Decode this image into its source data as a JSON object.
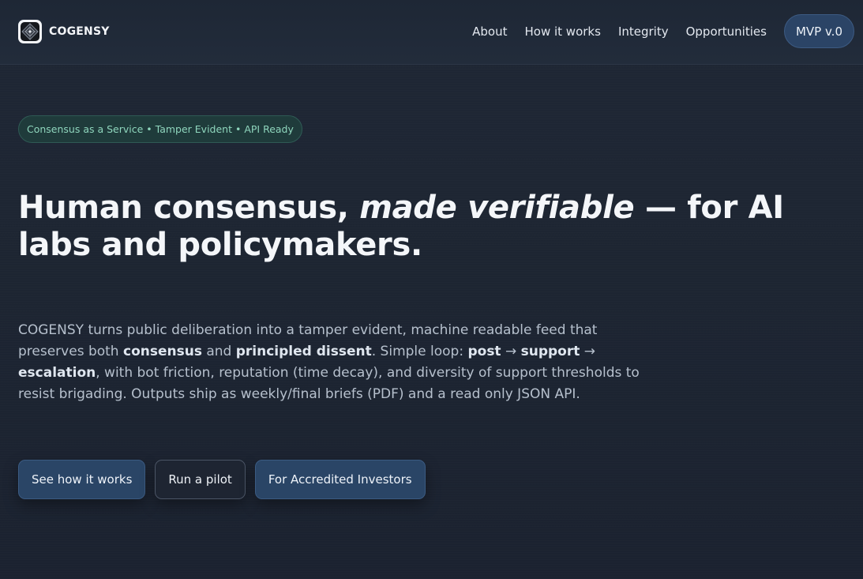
{
  "header": {
    "brand": "COGENSY",
    "logo_icon": "cogensy-logo-icon",
    "nav": [
      "About",
      "How it works",
      "Integrity",
      "Opportunities"
    ],
    "version_badge": "MVP v.0"
  },
  "hero": {
    "tagline": "Consensus as a Service • Tamper Evident • API Ready",
    "headline": {
      "part1": "Human consensus, ",
      "emphasis": "made verifiable",
      "part2": " — for AI labs and policymakers."
    },
    "description": {
      "t1": "COGENSY turns public deliberation into a tamper evident, machine readable feed that preserves both ",
      "b1": "consensus",
      "t2": " and ",
      "b2": "principled dissent",
      "t3": ". Simple loop: ",
      "b3": "post",
      "t4": " → ",
      "b4": "support",
      "t5": " → ",
      "b5": "escalation",
      "t6": ", with bot friction, reputation (time decay), and diversity of support thresholds to resist brigading. Outputs ship as weekly/final briefs (PDF) and a read only JSON API."
    },
    "buttons": {
      "primary": "See how it works",
      "secondary": "Run a pilot",
      "investors": "For Accredited Investors"
    }
  },
  "colors": {
    "background": "#1d2533",
    "accent": "#2a4566",
    "pill_text": "#8fd6bd"
  }
}
